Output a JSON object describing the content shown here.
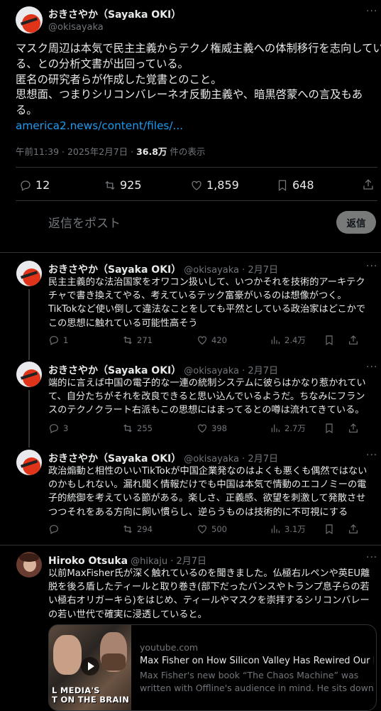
{
  "main_tweet": {
    "author_name": "おきさやか（Sayaka OKI）",
    "handle": "@okisayaka",
    "body_lines": [
      "マスク周辺は本気で民主主義からテクノ権威主義への体制移行を志向してい",
      "る、との分析文書が出回っている。",
      "匿名の研究者らが作成した覚書とのこと。",
      "思想面、つまりシリコンバレーネオ反動主義や、暗黒啓蒙への言及もあ",
      "る。"
    ],
    "link": "america2.news/content/files/...",
    "timestamp": "午前11:39 · 2025年2月7日 · ",
    "views": "36.8万",
    "views_suffix": " 件の表示",
    "replies": "12",
    "reposts": "925",
    "likes": "1,859",
    "bookmarks": "648",
    "reply_placeholder": "返信をポスト",
    "reply_button": "返信"
  },
  "thread": [
    {
      "author_name": "おきさやか（Sayaka OKI）",
      "handle": "@okisayaka · 2月7日",
      "body_lines": [
        "民主主義的な法治国家をオワコン扱いして、いつかそれを技術的アーキテク",
        "チャで書き換えてやる、考えているテック富豪がいるのは想像がつく。",
        "TikTokなど使い倒して違法なことをしても平然としている政治家はどこかで",
        "この思想に触れている可能性高そう"
      ],
      "replies": "1",
      "reposts": "271",
      "likes": "420",
      "views": "2.4万"
    },
    {
      "author_name": "おきさやか（Sayaka OKI）",
      "handle": "@okisayaka · 2月7日",
      "body_lines": [
        "端的に言えば中国の電子的な一連の統制システムに彼らはかなり惹かれてい",
        "て、自分たちがそれを改良できると思い込んでいるようだ。ちなみにフラン",
        "スのテクノクラート右派もこの思想にはまってるとの噂は流れてきている。"
      ],
      "replies": "3",
      "reposts": "255",
      "likes": "398",
      "views": "2.7万"
    },
    {
      "author_name": "おきさやか（Sayaka OKI）",
      "handle": "@okisayaka · 2月7日",
      "body_lines": [
        "政治煽動と相性のいいTikTokが中国企業発なのはよくも悪くも偶然ではない",
        "のかもしれない。漏れ聞く情報だけでも中国は本気で情動のエコノミーの電",
        "子的統御を考えている節がある。楽しさ、正義感、欲望を刺激して発散させ",
        "つつそれをある方向に飼い慣らし、逆らうものは技術的に不可視にする"
      ],
      "replies": "",
      "reposts": "294",
      "likes": "500",
      "views": "3.1万"
    }
  ],
  "reply_tweet": {
    "author_name": "Hiroko Otsuka",
    "handle": "@hikaju · 2月7日",
    "body_lines": [
      "以前MaxFisher氏が深く触れているのを聞きました。仏極右ルペンや英EU離",
      "脱を後ろ盾したティールと取り巻き(部下だったバンスやトランプ息子らの若",
      "い極右オリガーキら)をはじめ、ティールやマスクを崇拝するシリコンバレー",
      "の若い世代で確実に浸透していると。"
    ],
    "card": {
      "domain": "youtube.com",
      "title": "Max Fisher on How Silicon Valley Has Rewired Our Br...",
      "desc_lines": [
        "Max Fisher's new book “The Chaos Machine” was",
        "written with Offline's audience in mind. He sits down..."
      ],
      "thumb_text_lines": [
        "L MEDIA'S",
        "T ON THE BRAIN"
      ]
    }
  },
  "icons": {
    "reply": "reply-icon",
    "repost": "repost-icon",
    "like": "heart-icon",
    "bookmark": "bookmark-icon",
    "views": "views-icon",
    "share": "share-icon",
    "more": "more-icon"
  },
  "more_label": "···"
}
